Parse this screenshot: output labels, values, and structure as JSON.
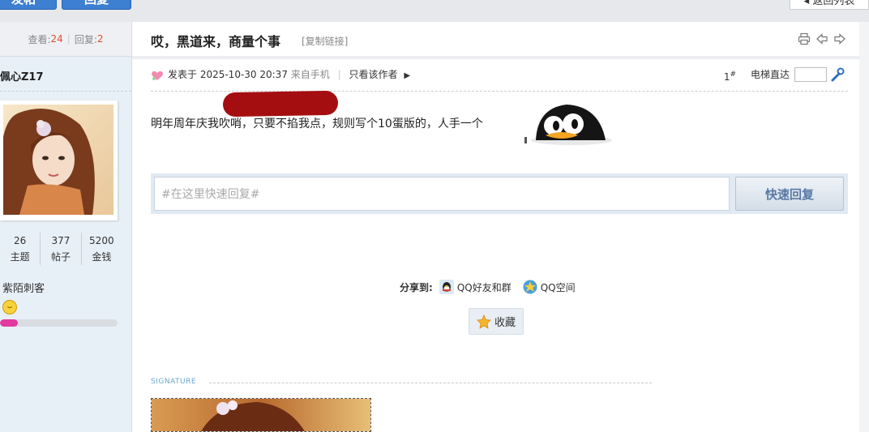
{
  "topbar": {
    "left_button_1": "发帖",
    "left_button_2": "回复",
    "back_button": "◂ 返回列表"
  },
  "thread_stats": {
    "views_label": "查看:",
    "views": "24",
    "replies_label": "回复:",
    "replies": "2"
  },
  "author": {
    "name": "佩心Z17",
    "counts": [
      {
        "value": "26",
        "label": "主题"
      },
      {
        "value": "377",
        "label": "帖子"
      },
      {
        "value": "5200",
        "label": "金钱"
      }
    ],
    "group": "紫陌刺客",
    "level_progress": 0.15
  },
  "post": {
    "title": "哎，黑道来，商量个事",
    "copy_link": "[复制链接]",
    "posted_label": "发表于 2025-10-30 20:37",
    "from": "来自手机",
    "only_author": "只看该作者",
    "floor": "1",
    "floor_mark": "#",
    "elevator": "电梯直达",
    "body": "明年周年庆我吹哨，只要不掐我点，规则写个10蛋版的，人手一个"
  },
  "quick_reply": {
    "placeholder": "#在这里快速回复#",
    "button": "快速回复"
  },
  "share": {
    "label": "分享到:",
    "qq": "QQ好友和群",
    "qzone": "QQ空间"
  },
  "favorite": {
    "label": "收藏"
  },
  "signature": {
    "label": "SIGNATURE"
  },
  "colors": {
    "accent": "#e0502d",
    "brand_blue": "#3d7fd0",
    "level_bar": "#e23aa0",
    "quick_reply_text": "#5778a4"
  },
  "icons": [
    "print-icon",
    "prev-thread-icon",
    "next-thread-icon",
    "heart-icon",
    "wrench-icon",
    "qq-icon",
    "qzone-icon",
    "star-icon",
    "smiley-icon"
  ]
}
